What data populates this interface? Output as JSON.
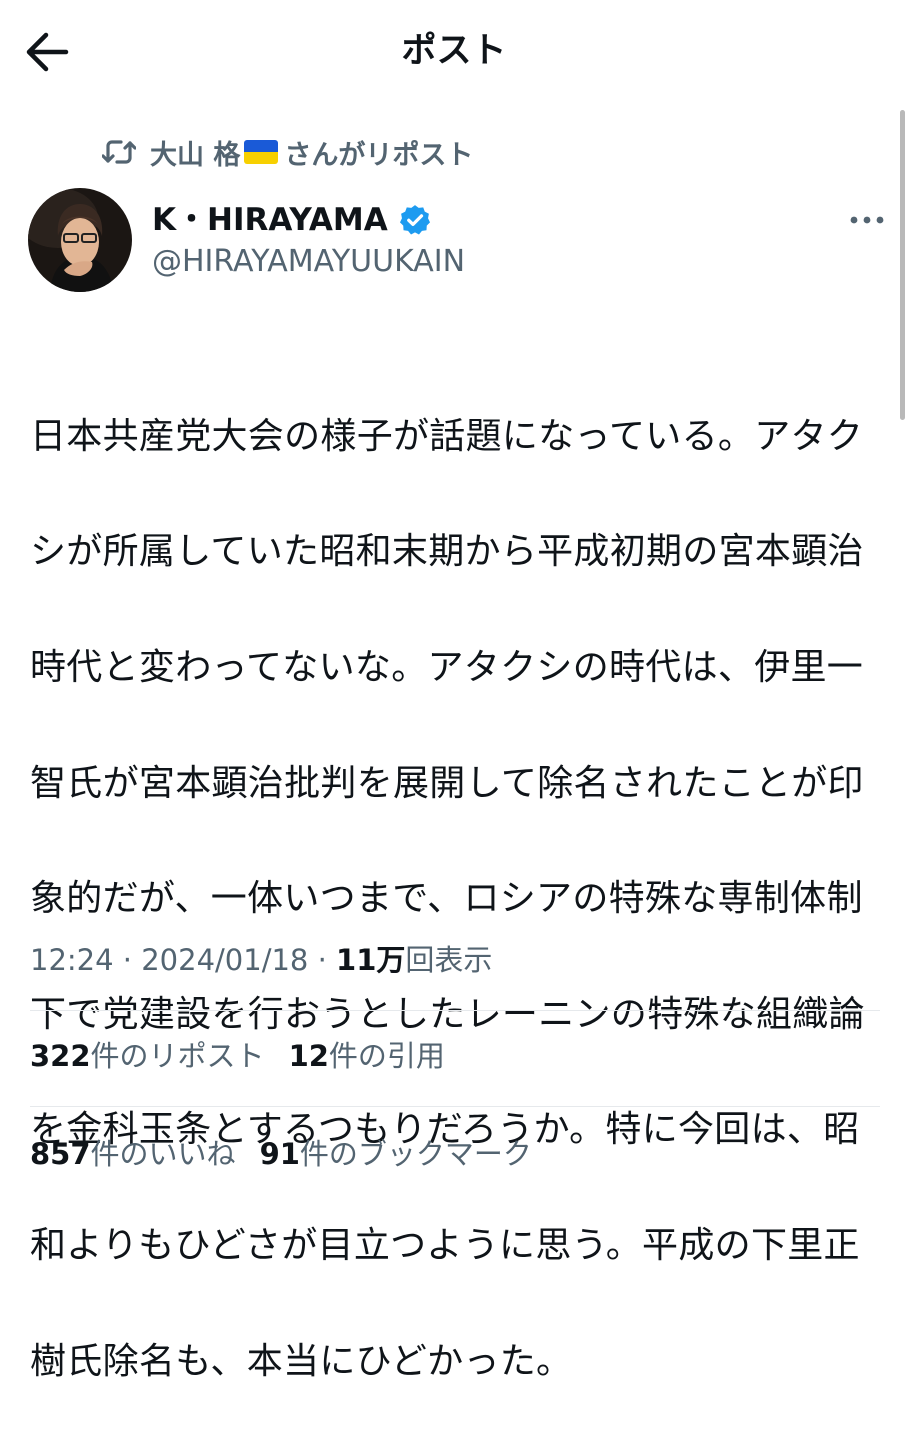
{
  "header": {
    "title": "ポスト"
  },
  "repost": {
    "user": "大山 格",
    "suffix": "さんがリポスト"
  },
  "author": {
    "name": "K・HIRAYAMA",
    "handle": "@HIRAYAMAYUUKAIN"
  },
  "tweet": {
    "lines": [
      "日本共産党大会の様子が話題になっている。アタク",
      "シが所属していた昭和末期から平成初期の宮本顕治",
      "時代と変わってないな。アタクシの時代は、伊里一",
      "智氏が宮本顕治批判を展開して除名されたことが印",
      "象的だが、一体いつまで、ロシアの特殊な専制体制",
      "下で党建設を行おうとしたレーニンの特殊な組織論",
      "を金科玉条とするつもりだろうか。特に今回は、昭",
      "和よりもひどさが目立つように思う。平成の下里正",
      "樹氏除名も、本当にひどかった。"
    ]
  },
  "meta": {
    "time": "12:24",
    "separator": "·",
    "date": "2024/01/18",
    "views_count": "11万",
    "views_label": "回表示"
  },
  "stats": {
    "reposts_count": "322",
    "reposts_label": "件のリポスト",
    "quotes_count": "12",
    "quotes_label": "件の引用",
    "likes_count": "857",
    "likes_label": "件のいいね",
    "bookmarks_count": "91",
    "bookmarks_label": "件のブックマーク"
  },
  "colors": {
    "text_primary": "#0f1419",
    "text_secondary": "#536471",
    "verified": "#1d9bf0",
    "divider": "#e6e9ec"
  },
  "icons": {
    "back": "arrow-left-icon",
    "repost": "repost-icon",
    "flag": "ukraine-flag-icon",
    "verified": "verified-badge-icon",
    "more": "more-horizontal-icon"
  }
}
